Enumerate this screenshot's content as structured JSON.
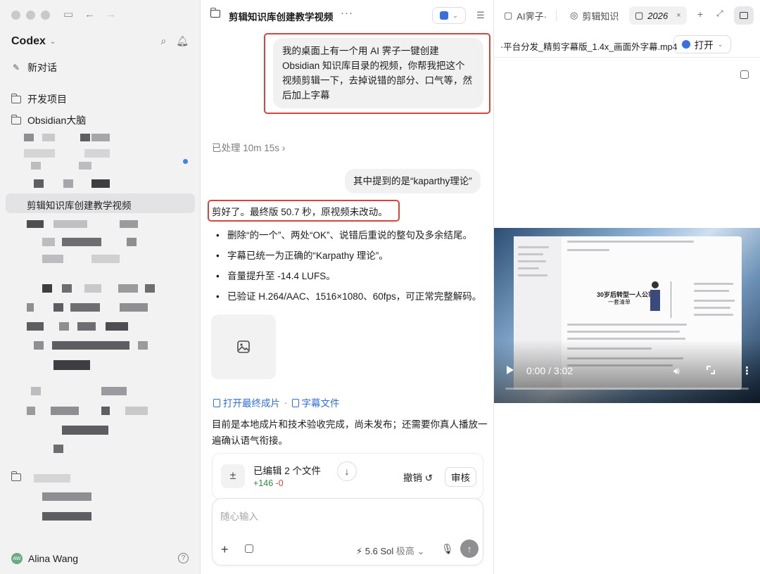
{
  "sidebar": {
    "brand": "Codex",
    "new_chat": "新对话",
    "folders": [
      {
        "label": "开发项目"
      },
      {
        "label": "Obsidian大脑"
      }
    ],
    "active_item": "剪辑知识库创建教学视频",
    "user": {
      "name": "Alina Wang",
      "initials": "AW"
    }
  },
  "chat": {
    "title": "剪辑知识库创建教学视频",
    "user_message_1": "我的桌面上有一个用 AI 霁子一键创建 Obsidian 知识库目录的视频，你帮我把这个视频剪辑一下，去掉说错的部分、口气等，然后加上字幕",
    "processed_label": "已处理 10m 15s",
    "processed_chevron": "›",
    "user_message_2": "其中提到的是“kaparthy理论”",
    "answer_headline": "剪好了。最终版 50.7 秒，原视频未改动。",
    "bullets": [
      "删除“的一个”、两处“OK”、说错后重说的整句及多余结尾。",
      "字幕已统一为正确的“Karpathy 理论”。",
      "音量提升至 -14.4 LUFS。",
      "已验证 H.264/AAC、1516×1080、60fps，可正常完整解码。"
    ],
    "link_final": "打开最终成片",
    "link_subtitle": "字幕文件",
    "link_separator": "·",
    "summary": "目前是本地成片和技术验收完成，尚未发布；还需要你真人播放一遍确认语气衔接。",
    "edit_card": {
      "title": "已编辑 2 个文件",
      "added": "+146",
      "removed": "-0",
      "undo": "撤销 ↺",
      "review": "审核"
    },
    "composer": {
      "placeholder": "随心输入",
      "model": "5.6 Sol",
      "model_mode": "极高"
    }
  },
  "right": {
    "tabs": [
      {
        "label": "AI霁子·"
      },
      {
        "label": "剪辑知识"
      },
      {
        "label": "2026",
        "close": "×"
      }
    ],
    "file_name": "·平台分发_精剪字幕版_1.4x_画面外字幕.mp4",
    "open_label": "打开",
    "video": {
      "time": "0:00 / 3:02",
      "progress": 0,
      "headline": "30岁后转型一人公司:",
      "headline2": "一套清单"
    }
  },
  "colors": {
    "accent_red": "#d8453d",
    "link_blue": "#2f6fd6",
    "added_green": "#2e8b45"
  }
}
